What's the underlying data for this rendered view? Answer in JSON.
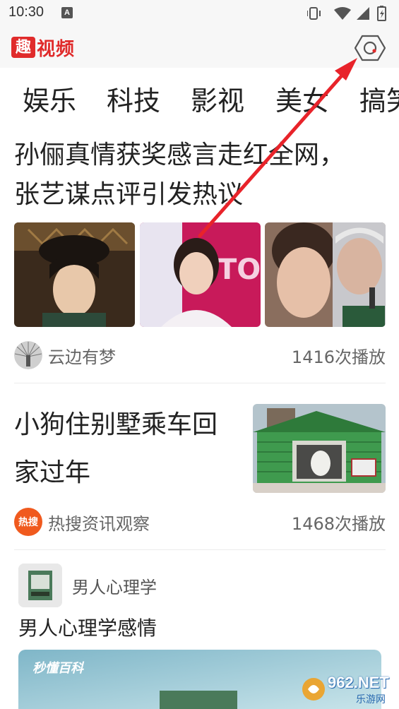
{
  "status_bar": {
    "time": "10:30",
    "notification_icon": "A"
  },
  "header": {
    "logo_char": "趣",
    "logo_rest": "视频",
    "settings_icon": "settings-hexagon-icon"
  },
  "tabs": [
    {
      "label": "娱乐"
    },
    {
      "label": "科技"
    },
    {
      "label": "影视"
    },
    {
      "label": "美女"
    },
    {
      "label": "搞笑"
    }
  ],
  "feed": [
    {
      "title_line1": "孙俪真情获奖感言走红全网，",
      "title_line2": "张艺谋点评引发热议",
      "author": "云边有梦",
      "plays": "1416次播放"
    },
    {
      "title_line1": "小狗住别墅乘车回",
      "title_line2": "家过年",
      "author": "热搜资讯观察",
      "author_badge": "热搜",
      "plays": "1468次播放"
    },
    {
      "channel": "男人心理学",
      "title": "男人心理学感情",
      "video_brand": "秒懂百科"
    }
  ],
  "watermark": {
    "text": "962.NET",
    "subtext": "乐游网"
  },
  "colors": {
    "brand_red": "#e02b2b",
    "arrow_red": "#e8232a",
    "text_primary": "#222222",
    "text_secondary": "#666666"
  }
}
